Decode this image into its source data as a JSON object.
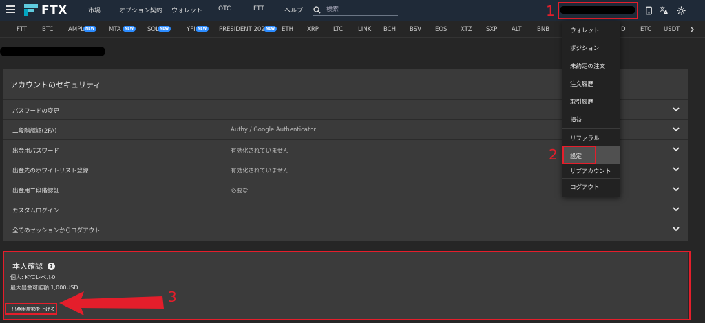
{
  "header": {
    "brand": "FTX",
    "nav": [
      "市場",
      "オプション契約",
      "ウォレット",
      "OTC",
      "FTT",
      "ヘルプ"
    ],
    "search_placeholder": "検索"
  },
  "ticker": [
    {
      "label": "FTT",
      "new": false
    },
    {
      "label": "BTC",
      "new": false
    },
    {
      "label": "AMPL",
      "new": true
    },
    {
      "label": "MTA",
      "new": true
    },
    {
      "label": "SOL",
      "new": true
    },
    {
      "label": "YFI",
      "new": true
    },
    {
      "label": "PRESIDENT 2020",
      "new": true
    },
    {
      "label": "ETH",
      "new": false
    },
    {
      "label": "XRP",
      "new": false
    },
    {
      "label": "LTC",
      "new": false
    },
    {
      "label": "LINK",
      "new": false
    },
    {
      "label": "BCH",
      "new": false
    },
    {
      "label": "BSV",
      "new": false
    },
    {
      "label": "EOS",
      "new": false
    },
    {
      "label": "XTZ",
      "new": false
    },
    {
      "label": "SXP",
      "new": false
    },
    {
      "label": "ALT",
      "new": false
    },
    {
      "label": "BNB",
      "new": false
    },
    {
      "label": "D",
      "new": false
    },
    {
      "label": "ETC",
      "new": false
    },
    {
      "label": "USDT",
      "new": false
    }
  ],
  "new_badge": "NEW",
  "security": {
    "title": "アカウントのセキュリティ",
    "rows": [
      {
        "label": "パスワードの変更",
        "value": ""
      },
      {
        "label": "二段階認証(2FA)",
        "value": "Authy / Google Authenticator"
      },
      {
        "label": "出金用パスワード",
        "value": "有効化されていません"
      },
      {
        "label": "出金先のホワイトリスト登録",
        "value": "有効化されていません"
      },
      {
        "label": "出金用二段階認証",
        "value": "必要な"
      },
      {
        "label": "カスタムログイン",
        "value": ""
      },
      {
        "label": "全てのセッションからログアウト",
        "value": ""
      }
    ]
  },
  "kyc": {
    "title": "本人確認",
    "line1": "個人: KYCレベル0",
    "line2": "最大出金可能額 1,000USD",
    "button": "出金限度額を上げる"
  },
  "dropdown": {
    "items": [
      "ウォレット",
      "ポジション",
      "未約定の注文",
      "注文履歴",
      "取引履歴",
      "損益",
      "リファラル",
      "設定",
      "サブアカウント",
      "ログアウト"
    ],
    "active_index": 7
  },
  "annotations": {
    "one": "1",
    "two": "2",
    "three": "3"
  },
  "colors": {
    "accent_red": "#e41e2b",
    "header_bg": "#1f2a38",
    "badge_blue": "#2c8cff"
  }
}
